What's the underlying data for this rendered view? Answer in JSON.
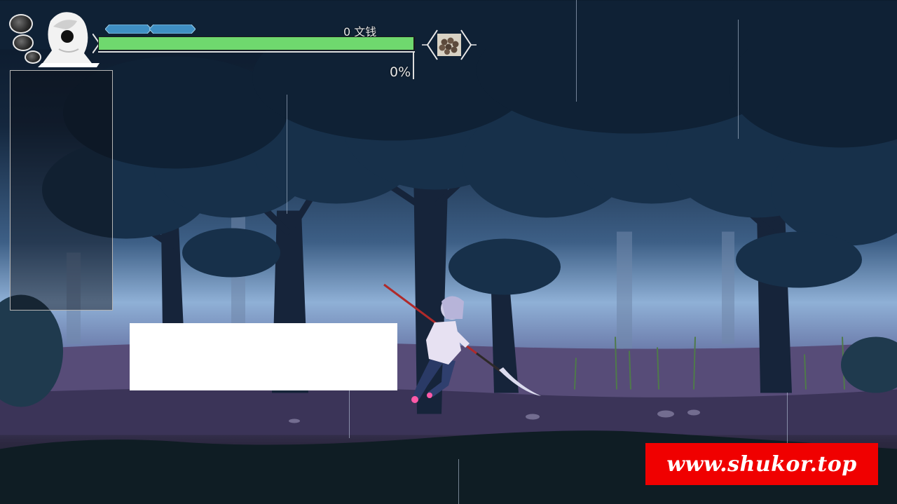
{
  "hud": {
    "currency_label": "0 文钱",
    "progress_text": "0%",
    "health_fraction": 1.0,
    "energy_segments_filled": 2,
    "soul_orbs_count": 3,
    "equipped_item_icon": "rice-ball-pile-icon"
  },
  "dialog": {
    "text": ""
  },
  "watermark": {
    "text": "www.shukor.top"
  },
  "colors": {
    "health": "#6fd86e",
    "energy": "#3f8fc4",
    "watermark_bg": "#f00000",
    "sky": "#8fb0d6",
    "foliage": "#17304a"
  },
  "scene": {
    "setting": "forest-night",
    "player_weapon": "naginata"
  }
}
